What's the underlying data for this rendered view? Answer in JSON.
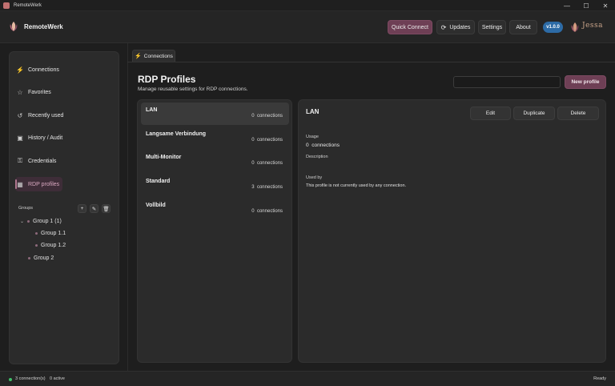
{
  "window": {
    "title": "RemoteWerk",
    "controls": [
      "—",
      "☐",
      "✕"
    ]
  },
  "header": {
    "brand": "RemoteWerk",
    "quick_connect": "Quick Connect",
    "updates": "Updates",
    "settings": "Settings",
    "about": "About",
    "version": "v1.0.0",
    "partner_logo_text": "Jessa"
  },
  "sidebar": {
    "items": [
      {
        "label": "Connections",
        "icon": "plug-icon",
        "glyph": "⚡"
      },
      {
        "label": "Favorites",
        "icon": "star-icon",
        "glyph": "☆"
      },
      {
        "label": "Recently used",
        "icon": "history-icon",
        "glyph": "↺"
      },
      {
        "label": "History / Audit",
        "icon": "image-icon",
        "glyph": "▣"
      },
      {
        "label": "Credentials",
        "icon": "key-icon",
        "glyph": "⚿"
      },
      {
        "label": "RDP profiles",
        "icon": "grid-icon",
        "glyph": "▦"
      }
    ],
    "active_index": 5,
    "groups_title": "Groups",
    "group_buttons": {
      "add": "+",
      "edit": "✎",
      "delete": "🗑"
    },
    "tree": [
      {
        "label": "Group 1 (1)"
      },
      {
        "label": "Group 1.1"
      },
      {
        "label": "Group 1.2"
      },
      {
        "label": "Group 2"
      }
    ]
  },
  "tab": {
    "label": "Connections"
  },
  "main": {
    "title": "RDP Profiles",
    "subtitle": "Manage reusable settings for RDP connections.",
    "search_value": "",
    "new_profile": "New profile"
  },
  "profiles": [
    {
      "name": "LAN",
      "count": "0",
      "unit": "connections"
    },
    {
      "name": "Langsame Verbindung",
      "count": "0",
      "unit": "connections"
    },
    {
      "name": "Multi-Monitor",
      "count": "0",
      "unit": "connections"
    },
    {
      "name": "Standard",
      "count": "3",
      "unit": "connections"
    },
    {
      "name": "Vollbild",
      "count": "0",
      "unit": "connections"
    }
  ],
  "detail": {
    "title": "LAN",
    "edit": "Edit",
    "duplicate": "Duplicate",
    "delete": "Delete",
    "usage_label": "Usage",
    "usage_count": "0",
    "usage_unit": "connections",
    "description_label": "Description",
    "used_by_label": "Used by",
    "used_by_text": "This profile is not currently used by any connection."
  },
  "status": {
    "connections": "3 connection(s)",
    "active": "0 active",
    "ready": "Ready"
  },
  "colors": {
    "accent": "#6e3f55",
    "version_badge": "#2d6ba6",
    "status_ok": "#3fbf6a"
  }
}
